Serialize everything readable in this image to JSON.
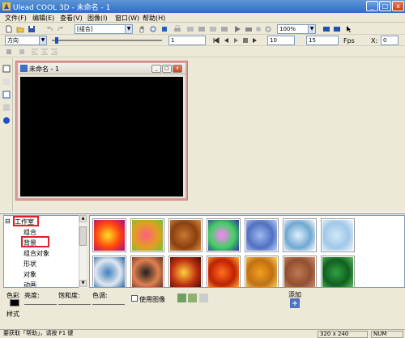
{
  "window": {
    "title": "Ulead COOL 3D - 未命名 - 1"
  },
  "menu": [
    "文件(F)",
    "编辑(E)",
    "查看(V)",
    "图像(I)",
    "窗口(W)",
    "帮助(H)"
  ],
  "toolbar1": {
    "object_combo": "[组合]",
    "zoom_combo": "100%"
  },
  "toolbar2": {
    "direction_combo": "方向",
    "frame_value": "1",
    "fps_value": "10",
    "frames_value": "15",
    "fps_label": "Fps",
    "x_label": "X:",
    "x_value": "0"
  },
  "document": {
    "title": "未命名 - 1"
  },
  "tree": {
    "items": [
      "工作室",
      "组合",
      "背景",
      "组合对象",
      "形状",
      "对象",
      "动画"
    ]
  },
  "thumbnails": [
    {
      "name": "sunburst",
      "c1": "#ffe020",
      "c2": "#ff4010",
      "c3": "#a01090"
    },
    {
      "name": "colorful",
      "c1": "#ff6080",
      "c2": "#e0a020",
      "c3": "#70c040"
    },
    {
      "name": "wood",
      "c1": "#c87830",
      "c2": "#8a4010",
      "c3": "#d89048"
    },
    {
      "name": "swirl",
      "c1": "#ff80ff",
      "c2": "#40d060",
      "c3": "#3030a0"
    },
    {
      "name": "water",
      "c1": "#a0b8f0",
      "c2": "#5070c0",
      "c3": "#c0d0ff"
    },
    {
      "name": "ice",
      "c1": "#e0f0ff",
      "c2": "#70a8d0",
      "c3": "#ffffff"
    },
    {
      "name": "frost",
      "c1": "#d0e8f8",
      "c2": "#a0c8e8",
      "c3": "#f0f8ff"
    },
    {
      "name": "clouds",
      "c1": "#4080c0",
      "c2": "#e0e8f0",
      "c3": "#2060a0"
    },
    {
      "name": "sunset",
      "c1": "#202020",
      "c2": "#e08050",
      "c3": "#603020"
    },
    {
      "name": "glow",
      "c1": "#ffd040",
      "c2": "#c03010",
      "c3": "#401000"
    },
    {
      "name": "sea-sunset",
      "c1": "#ff7020",
      "c2": "#c02000",
      "c3": "#ffb040"
    },
    {
      "name": "sand",
      "c1": "#f0a020",
      "c2": "#c07010",
      "c3": "#ffd060"
    },
    {
      "name": "brick",
      "c1": "#c07850",
      "c2": "#905030",
      "c3": "#d09070"
    },
    {
      "name": "grass",
      "c1": "#30a040",
      "c2": "#106020",
      "c3": "#60c060"
    }
  ],
  "bottom": {
    "color_label": "色彩",
    "brightness_label": "亮度:",
    "saturation_label": "饱和度:",
    "hue_label": "色调:",
    "use_image_label": "使用图像",
    "add_label": "添加",
    "style_label": "样式"
  },
  "status": {
    "help_text": "要获取「帮助」，请按 F1 键",
    "size": "320 x 240",
    "num": "NUM"
  }
}
